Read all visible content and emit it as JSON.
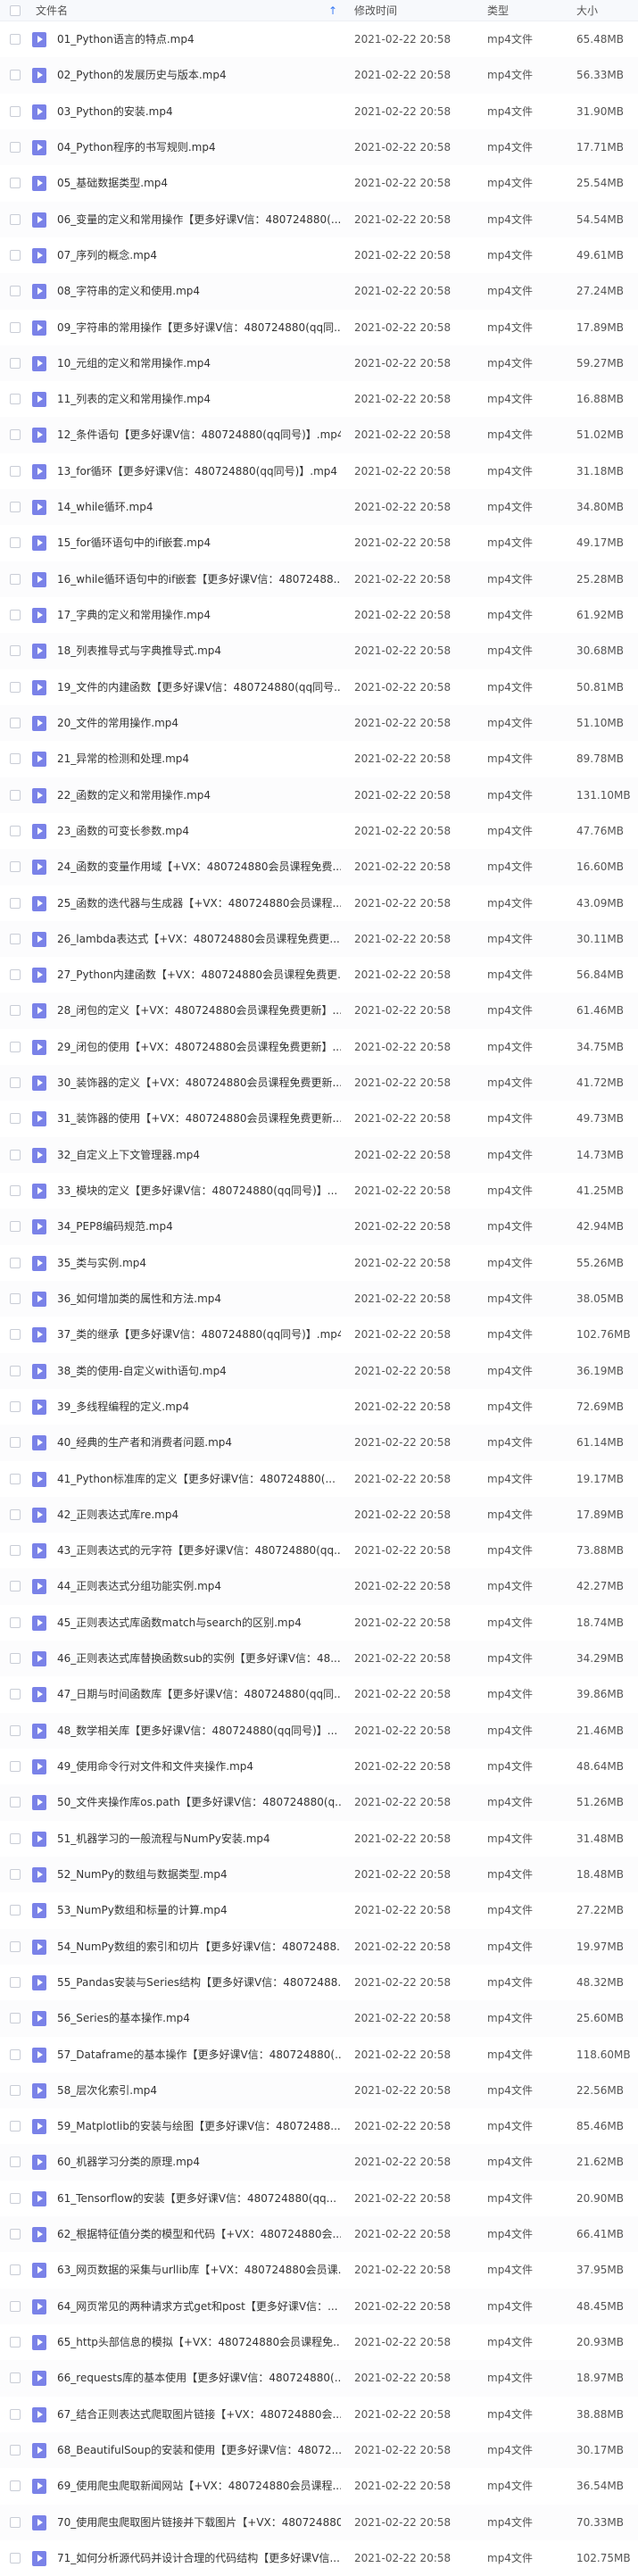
{
  "header": {
    "name": "文件名",
    "sort_icon": "↑",
    "date": "修改时间",
    "type": "类型",
    "size": "大小"
  },
  "colors": {
    "accent": "#3a7bf5",
    "file_icon": "#7a82e8"
  },
  "icons": {
    "file": "video-file-icon",
    "sort": "sort-ascending-icon"
  },
  "files": [
    {
      "name": "01_Python语言的特点.mp4",
      "date": "2021-02-22 20:58",
      "type": "mp4文件",
      "size": "65.48MB"
    },
    {
      "name": "02_Python的发展历史与版本.mp4",
      "date": "2021-02-22 20:58",
      "type": "mp4文件",
      "size": "56.33MB"
    },
    {
      "name": "03_Python的安装.mp4",
      "date": "2021-02-22 20:58",
      "type": "mp4文件",
      "size": "31.90MB"
    },
    {
      "name": "04_Python程序的书写规则.mp4",
      "date": "2021-02-22 20:58",
      "type": "mp4文件",
      "size": "17.71MB"
    },
    {
      "name": "05_基础数据类型.mp4",
      "date": "2021-02-22 20:58",
      "type": "mp4文件",
      "size": "25.54MB"
    },
    {
      "name": "06_变量的定义和常用操作【更多好课V信：480724880(...",
      "date": "2021-02-22 20:58",
      "type": "mp4文件",
      "size": "54.54MB"
    },
    {
      "name": "07_序列的概念.mp4",
      "date": "2021-02-22 20:58",
      "type": "mp4文件",
      "size": "49.61MB"
    },
    {
      "name": "08_字符串的定义和使用.mp4",
      "date": "2021-02-22 20:58",
      "type": "mp4文件",
      "size": "27.24MB"
    },
    {
      "name": "09_字符串的常用操作【更多好课V信：480724880(qq同...",
      "date": "2021-02-22 20:58",
      "type": "mp4文件",
      "size": "17.89MB"
    },
    {
      "name": "10_元组的定义和常用操作.mp4",
      "date": "2021-02-22 20:58",
      "type": "mp4文件",
      "size": "59.27MB"
    },
    {
      "name": "11_列表的定义和常用操作.mp4",
      "date": "2021-02-22 20:58",
      "type": "mp4文件",
      "size": "16.88MB"
    },
    {
      "name": "12_条件语句【更多好课V信：480724880(qq同号)】.mp4",
      "date": "2021-02-22 20:58",
      "type": "mp4文件",
      "size": "51.02MB"
    },
    {
      "name": "13_for循环【更多好课V信：480724880(qq同号)】.mp4",
      "date": "2021-02-22 20:58",
      "type": "mp4文件",
      "size": "31.18MB"
    },
    {
      "name": "14_while循环.mp4",
      "date": "2021-02-22 20:58",
      "type": "mp4文件",
      "size": "34.80MB"
    },
    {
      "name": "15_for循环语句中的if嵌套.mp4",
      "date": "2021-02-22 20:58",
      "type": "mp4文件",
      "size": "49.17MB"
    },
    {
      "name": "16_while循环语句中的if嵌套【更多好课V信：48072488...",
      "date": "2021-02-22 20:58",
      "type": "mp4文件",
      "size": "25.28MB"
    },
    {
      "name": "17_字典的定义和常用操作.mp4",
      "date": "2021-02-22 20:58",
      "type": "mp4文件",
      "size": "61.92MB"
    },
    {
      "name": "18_列表推导式与字典推导式.mp4",
      "date": "2021-02-22 20:58",
      "type": "mp4文件",
      "size": "30.68MB"
    },
    {
      "name": "19_文件的内建函数【更多好课V信：480724880(qq同号...",
      "date": "2021-02-22 20:58",
      "type": "mp4文件",
      "size": "50.81MB"
    },
    {
      "name": "20_文件的常用操作.mp4",
      "date": "2021-02-22 20:58",
      "type": "mp4文件",
      "size": "51.10MB"
    },
    {
      "name": "21_异常的检测和处理.mp4",
      "date": "2021-02-22 20:58",
      "type": "mp4文件",
      "size": "89.78MB"
    },
    {
      "name": "22_函数的定义和常用操作.mp4",
      "date": "2021-02-22 20:58",
      "type": "mp4文件",
      "size": "131.10MB"
    },
    {
      "name": "23_函数的可变长参数.mp4",
      "date": "2021-02-22 20:58",
      "type": "mp4文件",
      "size": "47.76MB"
    },
    {
      "name": "24_函数的变量作用域【+VX：480724880会员课程免费...",
      "date": "2021-02-22 20:58",
      "type": "mp4文件",
      "size": "16.60MB"
    },
    {
      "name": "25_函数的迭代器与生成器【+VX：480724880会员课程...",
      "date": "2021-02-22 20:58",
      "type": "mp4文件",
      "size": "43.09MB"
    },
    {
      "name": "26_lambda表达式【+VX：480724880会员课程免费更...",
      "date": "2021-02-22 20:58",
      "type": "mp4文件",
      "size": "30.11MB"
    },
    {
      "name": "27_Python内建函数【+VX：480724880会员课程免费更...",
      "date": "2021-02-22 20:58",
      "type": "mp4文件",
      "size": "56.84MB"
    },
    {
      "name": "28_闭包的定义【+VX：480724880会员课程免费更新】...",
      "date": "2021-02-22 20:58",
      "type": "mp4文件",
      "size": "61.46MB"
    },
    {
      "name": "29_闭包的使用【+VX：480724880会员课程免费更新】...",
      "date": "2021-02-22 20:58",
      "type": "mp4文件",
      "size": "34.75MB"
    },
    {
      "name": "30_装饰器的定义【+VX：480724880会员课程免费更新...",
      "date": "2021-02-22 20:58",
      "type": "mp4文件",
      "size": "41.72MB"
    },
    {
      "name": "31_装饰器的使用【+VX：480724880会员课程免费更新...",
      "date": "2021-02-22 20:58",
      "type": "mp4文件",
      "size": "49.73MB"
    },
    {
      "name": "32_自定义上下文管理器.mp4",
      "date": "2021-02-22 20:58",
      "type": "mp4文件",
      "size": "14.73MB"
    },
    {
      "name": "33_模块的定义【更多好课V信：480724880(qq同号)】...",
      "date": "2021-02-22 20:58",
      "type": "mp4文件",
      "size": "41.25MB"
    },
    {
      "name": "34_PEP8编码规范.mp4",
      "date": "2021-02-22 20:58",
      "type": "mp4文件",
      "size": "42.94MB"
    },
    {
      "name": "35_类与实例.mp4",
      "date": "2021-02-22 20:58",
      "type": "mp4文件",
      "size": "55.26MB"
    },
    {
      "name": "36_如何增加类的属性和方法.mp4",
      "date": "2021-02-22 20:58",
      "type": "mp4文件",
      "size": "38.05MB"
    },
    {
      "name": "37_类的继承【更多好课V信：480724880(qq同号)】.mp4",
      "date": "2021-02-22 20:58",
      "type": "mp4文件",
      "size": "102.76MB"
    },
    {
      "name": "38_类的使用-自定义with语句.mp4",
      "date": "2021-02-22 20:58",
      "type": "mp4文件",
      "size": "36.19MB"
    },
    {
      "name": "39_多线程编程的定义.mp4",
      "date": "2021-02-22 20:58",
      "type": "mp4文件",
      "size": "72.69MB"
    },
    {
      "name": "40_经典的生产者和消费者问题.mp4",
      "date": "2021-02-22 20:58",
      "type": "mp4文件",
      "size": "61.14MB"
    },
    {
      "name": "41_Python标准库的定义【更多好课V信：480724880(...",
      "date": "2021-02-22 20:58",
      "type": "mp4文件",
      "size": "19.17MB"
    },
    {
      "name": "42_正则表达式库re.mp4",
      "date": "2021-02-22 20:58",
      "type": "mp4文件",
      "size": "17.89MB"
    },
    {
      "name": "43_正则表达式的元字符【更多好课V信：480724880(qq...",
      "date": "2021-02-22 20:58",
      "type": "mp4文件",
      "size": "73.88MB"
    },
    {
      "name": "44_正则表达式分组功能实例.mp4",
      "date": "2021-02-22 20:58",
      "type": "mp4文件",
      "size": "42.27MB"
    },
    {
      "name": "45_正则表达式库函数match与search的区别.mp4",
      "date": "2021-02-22 20:58",
      "type": "mp4文件",
      "size": "18.74MB"
    },
    {
      "name": "46_正则表达式库替换函数sub的实例【更多好课V信：48...",
      "date": "2021-02-22 20:58",
      "type": "mp4文件",
      "size": "34.29MB"
    },
    {
      "name": "47_日期与时间函数库【更多好课V信：480724880(qq同...",
      "date": "2021-02-22 20:58",
      "type": "mp4文件",
      "size": "39.86MB"
    },
    {
      "name": "48_数学相关库【更多好课V信：480724880(qq同号)】...",
      "date": "2021-02-22 20:58",
      "type": "mp4文件",
      "size": "21.46MB"
    },
    {
      "name": "49_使用命令行对文件和文件夹操作.mp4",
      "date": "2021-02-22 20:58",
      "type": "mp4文件",
      "size": "48.64MB"
    },
    {
      "name": "50_文件夹操作库os.path【更多好课V信：480724880(q...",
      "date": "2021-02-22 20:58",
      "type": "mp4文件",
      "size": "51.26MB"
    },
    {
      "name": "51_机器学习的一般流程与NumPy安装.mp4",
      "date": "2021-02-22 20:58",
      "type": "mp4文件",
      "size": "31.48MB"
    },
    {
      "name": "52_NumPy的数组与数据类型.mp4",
      "date": "2021-02-22 20:58",
      "type": "mp4文件",
      "size": "18.48MB"
    },
    {
      "name": "53_NumPy数组和标量的计算.mp4",
      "date": "2021-02-22 20:58",
      "type": "mp4文件",
      "size": "27.22MB"
    },
    {
      "name": "54_NumPy数组的索引和切片【更多好课V信：48072488...",
      "date": "2021-02-22 20:58",
      "type": "mp4文件",
      "size": "19.97MB"
    },
    {
      "name": "55_Pandas安装与Series结构【更多好课V信：48072488...",
      "date": "2021-02-22 20:58",
      "type": "mp4文件",
      "size": "48.32MB"
    },
    {
      "name": "56_Series的基本操作.mp4",
      "date": "2021-02-22 20:58",
      "type": "mp4文件",
      "size": "25.60MB"
    },
    {
      "name": "57_Dataframe的基本操作【更多好课V信：480724880(...",
      "date": "2021-02-22 20:58",
      "type": "mp4文件",
      "size": "118.60MB"
    },
    {
      "name": "58_层次化索引.mp4",
      "date": "2021-02-22 20:58",
      "type": "mp4文件",
      "size": "22.56MB"
    },
    {
      "name": "59_Matplotlib的安装与绘图【更多好课V信：48072488...",
      "date": "2021-02-22 20:58",
      "type": "mp4文件",
      "size": "85.46MB"
    },
    {
      "name": "60_机器学习分类的原理.mp4",
      "date": "2021-02-22 20:58",
      "type": "mp4文件",
      "size": "21.62MB"
    },
    {
      "name": "61_Tensorflow的安装【更多好课V信：480724880(qq...",
      "date": "2021-02-22 20:58",
      "type": "mp4文件",
      "size": "20.90MB"
    },
    {
      "name": "62_根据特征值分类的模型和代码【+VX：480724880会...",
      "date": "2021-02-22 20:58",
      "type": "mp4文件",
      "size": "66.41MB"
    },
    {
      "name": "63_网页数据的采集与urllib库【+VX：480724880会员课...",
      "date": "2021-02-22 20:58",
      "type": "mp4文件",
      "size": "37.95MB"
    },
    {
      "name": "64_网页常见的两种请求方式get和post【更多好课V信：...",
      "date": "2021-02-22 20:58",
      "type": "mp4文件",
      "size": "48.45MB"
    },
    {
      "name": "65_http头部信息的模拟【+VX：480724880会员课程免...",
      "date": "2021-02-22 20:58",
      "type": "mp4文件",
      "size": "20.93MB"
    },
    {
      "name": "66_requests库的基本使用【更多好课V信：480724880(...",
      "date": "2021-02-22 20:58",
      "type": "mp4文件",
      "size": "18.97MB"
    },
    {
      "name": "67_结合正则表达式爬取图片链接【+VX：480724880会...",
      "date": "2021-02-22 20:58",
      "type": "mp4文件",
      "size": "38.88MB"
    },
    {
      "name": "68_BeautifulSoup的安装和使用【更多好课V信：48072...",
      "date": "2021-02-22 20:58",
      "type": "mp4文件",
      "size": "30.17MB"
    },
    {
      "name": "69_使用爬虫爬取新闻网站【+VX：480724880会员课程...",
      "date": "2021-02-22 20:58",
      "type": "mp4文件",
      "size": "36.54MB"
    },
    {
      "name": "70_使用爬虫爬取图片链接并下载图片【+VX：480724880...",
      "date": "2021-02-22 20:58",
      "type": "mp4文件",
      "size": "70.33MB"
    },
    {
      "name": "71_如何分析源代码并设计合理的代码结构【更多好课V信...",
      "date": "2021-02-22 20:58",
      "type": "mp4文件",
      "size": "102.75MB"
    }
  ]
}
